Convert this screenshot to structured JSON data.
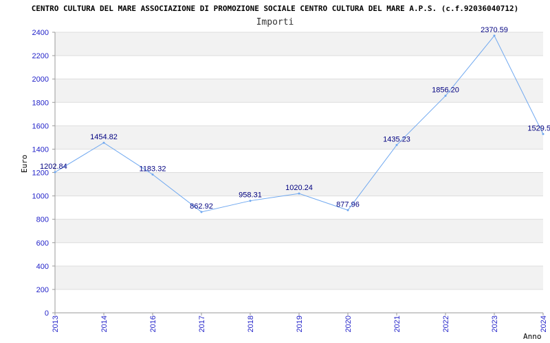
{
  "chart_data": {
    "type": "line",
    "title": "CENTRO CULTURA DEL MARE ASSOCIAZIONE DI PROMOZIONE SOCIALE CENTRO CULTURA DEL MARE A.P.S. (c.f.92036040712)",
    "subtitle": "Importi",
    "xlabel": "Anno",
    "ylabel": "Euro",
    "categories": [
      "2013",
      "2014",
      "2016",
      "2017",
      "2018",
      "2019",
      "2020",
      "2021",
      "2022",
      "2023",
      "2024"
    ],
    "values": [
      1202.84,
      1454.82,
      1183.32,
      862.92,
      958.31,
      1020.24,
      877.96,
      1435.23,
      1856.2,
      2370.59,
      1529.5
    ],
    "data_labels": [
      "1202.84",
      "1454.82",
      "1183.32",
      "862.92",
      "958.31",
      "1020.24",
      "877.96",
      "1435.23",
      "1856.20",
      "2370.59",
      "1529.5"
    ],
    "ylim": [
      0,
      2400
    ],
    "yticks": [
      "0",
      "200",
      "400",
      "600",
      "800",
      "1000",
      "1200",
      "1400",
      "1600",
      "1800",
      "2000",
      "2200",
      "2400"
    ],
    "grid": true,
    "legend": "none",
    "colors": {
      "line": "#6fa8f0",
      "tick_labels": "#1f1fc8",
      "data_labels": "#000080",
      "band": "#f2f2f2",
      "gridline": "#dddddd"
    }
  }
}
